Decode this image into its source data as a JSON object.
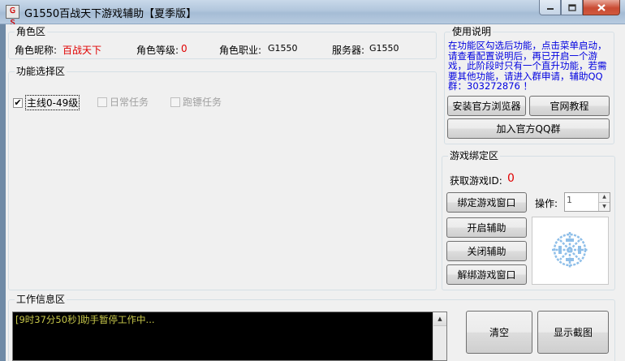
{
  "window": {
    "app_icon_text": "ＧＳ",
    "title": "G1550百战天下游戏辅助【夏季版】",
    "minimize_icon": "minimize-icon",
    "maximize_icon": "maximize-icon",
    "close_icon": "close-icon"
  },
  "role": {
    "group_title": "角色区",
    "nickname_label": "角色昵称:",
    "nickname_value": "百战天下",
    "level_label": "角色等级:",
    "level_value": "0",
    "job_label": "角色职业:",
    "job_value": "G1550",
    "server_label": "服务器:",
    "server_value": "G1550"
  },
  "functions": {
    "group_title": "功能选择区",
    "items": [
      {
        "label": "主线0-49级",
        "checked": true,
        "enabled": true
      },
      {
        "label": "日常任务",
        "checked": false,
        "enabled": false
      },
      {
        "label": "跑镖任务",
        "checked": false,
        "enabled": false
      }
    ]
  },
  "usage": {
    "group_title": "使用说明",
    "text": "在功能区勾选后功能，点击菜单启动，请查看配置说明后，再已开启一个游戏，此阶段时只有一个直升功能，若需要其他功能，请进入群申请，辅助QQ群：303272876 ！",
    "install_browser_button": "安装官方浏览器",
    "tutorial_button": "官网教程",
    "join_qq_button": "加入官方QQ群"
  },
  "binding": {
    "group_title": "游戏绑定区",
    "game_id_label": "获取游戏ID:",
    "game_id_value": "0",
    "bind_button": "绑定游戏窗口",
    "start_button": "开启辅助",
    "stop_button": "关闭辅助",
    "unbind_button": "解绑游戏窗口",
    "operation_label": "操作:",
    "operation_value": "1",
    "logo_icon": "snowflake-emblem-icon"
  },
  "work_info": {
    "group_title": "工作信息区",
    "log_lines": [
      "[9时37分50秒]助手暂停工作中..."
    ],
    "clear_button": "清空",
    "screenshot_button": "显示截图"
  },
  "colors": {
    "accent_text": "#e00000",
    "usage_text": "#0000e0",
    "log_background": "#000000",
    "log_text": "#c8c84a"
  }
}
